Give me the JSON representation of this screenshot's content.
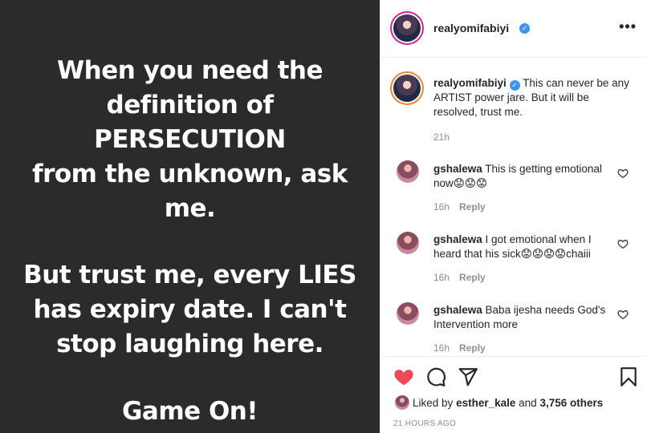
{
  "post": {
    "lines": [
      "When you need the",
      "definition of",
      "PERSECUTION",
      "from the unknown, ask",
      "me.",
      "But trust me, every LIES",
      "has expiry date. I can't",
      "stop laughing here.",
      "Game On!"
    ]
  },
  "header": {
    "username": "realyomifabiyi",
    "verified_mark": "✓",
    "more_label": "•••"
  },
  "caption": {
    "username": "realyomifabiyi",
    "verified_mark": "✓",
    "text": "This can never be any ARTIST power jare. But it will be resolved, trust me.",
    "age": "21h"
  },
  "comments": [
    {
      "username": "gshalewa",
      "text": "This is getting emotional now😟😟😟",
      "age": "16h",
      "reply": "Reply"
    },
    {
      "username": "gshalewa",
      "text": "I got emotional when I heard that his sick😟😟😟😟chaiii",
      "age": "16h",
      "reply": "Reply"
    },
    {
      "username": "gshalewa",
      "text": "Baba ijesha needs God's Intervention more",
      "age": "16h",
      "reply": "Reply"
    }
  ],
  "footer": {
    "liked_by_prefix": "Liked by",
    "liked_by_user": "esther_kale",
    "liked_by_and": "and",
    "likes_count": "3,756 others",
    "timestamp": "21 HOURS AGO"
  },
  "icons": {
    "like": "heart-icon",
    "comment": "comment-icon",
    "share": "paper-plane-icon",
    "save": "bookmark-icon",
    "comment_like": "heart-outline-icon"
  },
  "colors": {
    "post_background": "#2b2b2b",
    "like_red": "#ed4956",
    "verified_blue": "#3897f0",
    "muted": "#8e8e8e"
  }
}
